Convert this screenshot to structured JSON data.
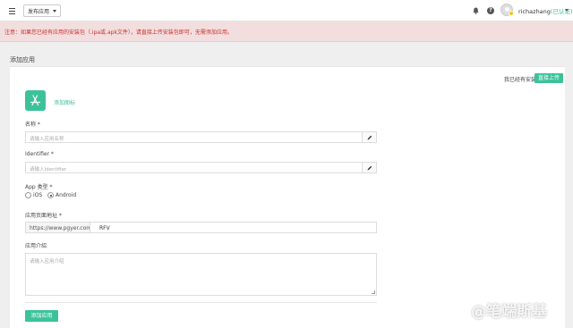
{
  "topbar": {
    "publish_label": "发布应用",
    "username": "richazhang",
    "user_cert": "(已认证)",
    "help_glyph": "?"
  },
  "notice": {
    "text": "注意：如果您已经有应用的安装包（.ipa或.apk文件），请直接上传安装包即可，无需添加应用。"
  },
  "page": {
    "section_title": "添加应用",
    "have_package": "我已经有安装包",
    "direct_upload": "直接上传",
    "add_icon": "添加图标",
    "name_label": "名称 *",
    "name_placeholder": "请输入应用名称",
    "identifier_label": "Identifier *",
    "identifier_placeholder": "请输入Identifier",
    "app_type_label": "App 类型 *",
    "type_options": [
      "iOS",
      "Android"
    ],
    "type_selected": "Android",
    "url_label": "应用页面地址 *",
    "url_prefix": "https://www.pgyer.com/",
    "url_value": "RFV",
    "intro_label": "应用介绍",
    "intro_placeholder": "请输入应用介绍",
    "submit_label": "添加应用"
  },
  "watermark": {
    "text": "@笔端斯基"
  },
  "colors": {
    "accent": "#3cc29a",
    "notice_bg": "#f2dede",
    "notice_text": "#c9302c"
  }
}
